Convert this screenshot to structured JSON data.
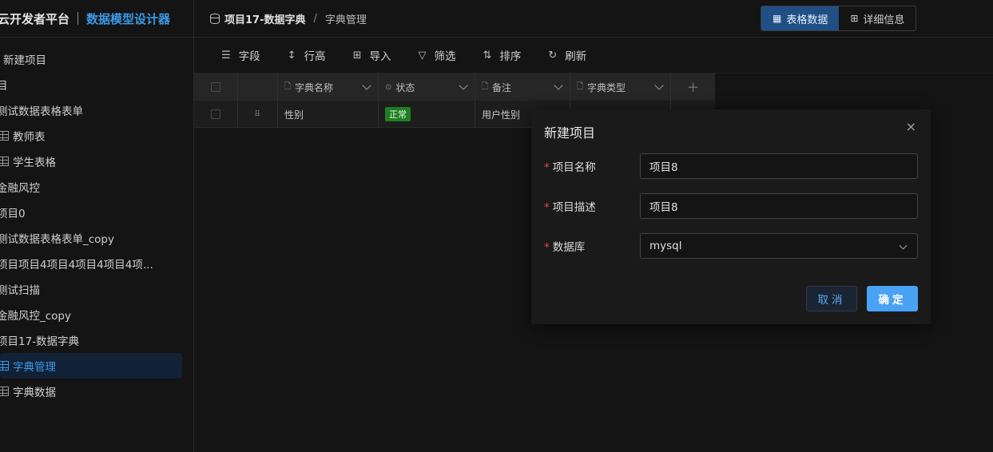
{
  "brand": {
    "title": "云开发者平台",
    "subtitle": "数据模型设计器"
  },
  "sidebar": {
    "items": [
      {
        "label": "新建项目",
        "icon": "plus-icon"
      },
      {
        "label": "目",
        "icon": ""
      },
      {
        "label": "测试数据表格表单",
        "icon": ""
      },
      {
        "label": "教师表",
        "icon": "table-icon"
      },
      {
        "label": "学生表格",
        "icon": "table-icon"
      },
      {
        "label": "金融风控",
        "icon": ""
      },
      {
        "label": "项目0",
        "icon": ""
      },
      {
        "label": "测试数据表格表单_copy",
        "icon": ""
      },
      {
        "label": "项目项目4项目4项目4项目4项...",
        "icon": ""
      },
      {
        "label": "测试扫描",
        "icon": ""
      },
      {
        "label": "金融风控_copy",
        "icon": ""
      },
      {
        "label": "项目17-数据字典",
        "icon": ""
      },
      {
        "label": "字典管理",
        "icon": "table-icon",
        "active": true
      },
      {
        "label": "字典数据",
        "icon": "table-icon"
      }
    ]
  },
  "header": {
    "breadcrumb": [
      "项目17-数据字典",
      "字典管理"
    ],
    "breadcrumb_sep": "/",
    "views": [
      {
        "label": "表格数据",
        "icon": "table-icon",
        "active": true
      },
      {
        "label": "详细信息",
        "icon": "grid-icon",
        "active": false
      }
    ]
  },
  "toolbar": {
    "items": [
      {
        "label": "字段",
        "icon": "list-icon",
        "glyph": "☰"
      },
      {
        "label": "行高",
        "icon": "row-height-icon",
        "glyph": "↕"
      },
      {
        "label": "导入",
        "icon": "import-icon",
        "glyph": "⊞"
      },
      {
        "label": "筛选",
        "icon": "filter-icon",
        "glyph": "▽"
      },
      {
        "label": "排序",
        "icon": "sort-icon",
        "glyph": "⇅"
      },
      {
        "label": "刷新",
        "icon": "refresh-icon",
        "glyph": "↻"
      }
    ]
  },
  "table": {
    "columns": [
      {
        "label": "字典名称",
        "icon_glyph": "🗋"
      },
      {
        "label": "状态",
        "icon_glyph": "⊙"
      },
      {
        "label": "备注",
        "icon_glyph": "🗋"
      },
      {
        "label": "字典类型",
        "icon_glyph": "🗋"
      }
    ],
    "add_column": "+",
    "rows": [
      {
        "drag": "⠿",
        "name": "性别",
        "status": "正常",
        "remark": "用户性别",
        "type": ""
      }
    ]
  },
  "modal": {
    "title": "新建项目",
    "close": "×",
    "fields": [
      {
        "label": "项目名称",
        "value": "项目8",
        "required_mark": "*"
      },
      {
        "label": "项目描述",
        "value": "项目8",
        "required_mark": "*"
      },
      {
        "label": "数据库",
        "value": "mysql",
        "required_mark": "*"
      }
    ],
    "cancel_label": "取消",
    "ok_label": "确定"
  },
  "colors": {
    "accent": "#3c9ae8",
    "primary_button": "#4aa2f5",
    "status_green": "#1e7f22",
    "required": "#e84749"
  }
}
